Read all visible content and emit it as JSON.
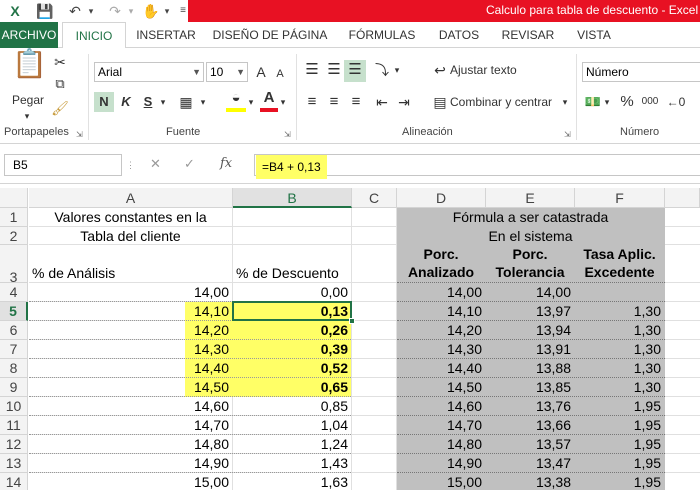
{
  "window": {
    "title": "Calculo para tabla de descuento -  Excel"
  },
  "ribbon_tabs": [
    "ARCHIVO",
    "INICIO",
    "INSERTAR",
    "DISEÑO DE PÁGINA",
    "FÓRMULAS",
    "DATOS",
    "REVISAR",
    "VISTA"
  ],
  "ribbon": {
    "paste_label": "Pegar",
    "font_name": "Arial",
    "font_size": "10",
    "grow_font": "A",
    "shrink_font": "A",
    "bold": "N",
    "italic": "K",
    "underline": "S",
    "wrap_text": "Ajustar texto",
    "merge_center": "Combinar y centrar",
    "number_format": "Número",
    "percent": "%",
    "thousands": "000",
    "groups": [
      "Portapapeles",
      "Fuente",
      "Alineación",
      "Número"
    ]
  },
  "formula_bar": {
    "name_box": "B5",
    "formula": "=B4 + 0,13",
    "fx": "fx"
  },
  "columns": [
    "A",
    "B",
    "C",
    "D",
    "E",
    "F"
  ],
  "rows": [
    "1",
    "2",
    "3",
    "4",
    "5",
    "6",
    "7",
    "8",
    "9",
    "10",
    "11",
    "12",
    "13",
    "14"
  ],
  "header_cells": {
    "a1": "Valores constantes en la",
    "a2": "Tabla del cliente",
    "a3": "% de Análisis",
    "b3": "% de Descuento",
    "d1": "Fórmula a ser catastrada",
    "d2": "En el sistema",
    "d3a": "Porc.",
    "d3b": "Analizado",
    "e3a": "Porc.",
    "e3b": "Tolerancia",
    "f3a": "Tasa Aplic.",
    "f3b": "Excedente"
  },
  "table": [
    {
      "a": "14,00",
      "b": "0,00",
      "d": "14,00",
      "e": "14,00",
      "f": ""
    },
    {
      "a": "14,10",
      "b": "0,13",
      "d": "14,10",
      "e": "13,97",
      "f": "1,30"
    },
    {
      "a": "14,20",
      "b": "0,26",
      "d": "14,20",
      "e": "13,94",
      "f": "1,30"
    },
    {
      "a": "14,30",
      "b": "0,39",
      "d": "14,30",
      "e": "13,91",
      "f": "1,30"
    },
    {
      "a": "14,40",
      "b": "0,52",
      "d": "14,40",
      "e": "13,88",
      "f": "1,30"
    },
    {
      "a": "14,50",
      "b": "0,65",
      "d": "14,50",
      "e": "13,85",
      "f": "1,30"
    },
    {
      "a": "14,60",
      "b": "0,85",
      "d": "14,60",
      "e": "13,76",
      "f": "1,95"
    },
    {
      "a": "14,70",
      "b": "1,04",
      "d": "14,70",
      "e": "13,66",
      "f": "1,95"
    },
    {
      "a": "14,80",
      "b": "1,24",
      "d": "14,80",
      "e": "13,57",
      "f": "1,95"
    },
    {
      "a": "14,90",
      "b": "1,43",
      "d": "14,90",
      "e": "13,47",
      "f": "1,95"
    },
    {
      "a": "15,00",
      "b": "1,63",
      "d": "15,00",
      "e": "13,38",
      "f": "1,95"
    }
  ],
  "colors": {
    "excel_green": "#217346",
    "title_red": "#e81123",
    "highlight_yellow": "#ffff66",
    "gray_fill": "#c0c0c0"
  }
}
